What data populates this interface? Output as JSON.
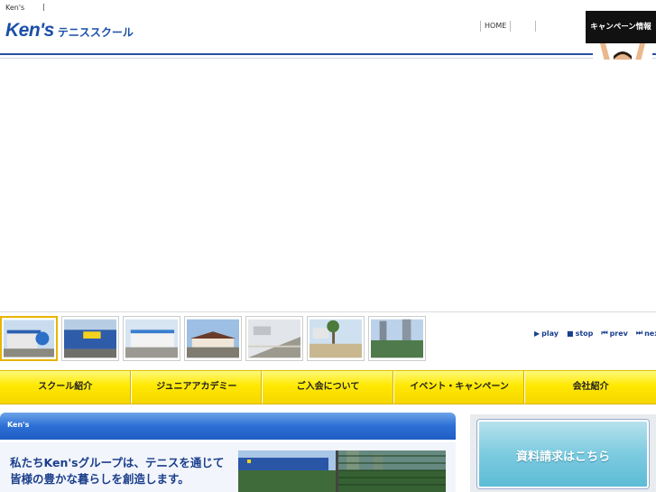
{
  "topbar": {
    "brand": "Ken's",
    "separator": "|"
  },
  "header": {
    "logo_brand": "Ken's",
    "logo_school": "テニススクール",
    "nav": [
      {
        "label": "HOME"
      },
      {
        "label": ""
      },
      {
        "label": ""
      }
    ]
  },
  "campaign": {
    "label": "キャンペーン情報"
  },
  "slideshow": {
    "thumbnails": [
      {
        "name": "thumb-1",
        "active": true
      },
      {
        "name": "thumb-2",
        "active": false
      },
      {
        "name": "thumb-3",
        "active": false
      },
      {
        "name": "thumb-4",
        "active": false
      },
      {
        "name": "thumb-5",
        "active": false
      },
      {
        "name": "thumb-6",
        "active": false
      },
      {
        "name": "thumb-7",
        "active": false
      }
    ],
    "controls": {
      "play": "play",
      "stop": "stop",
      "prev": "prev",
      "next": "next"
    }
  },
  "main_nav": {
    "items": [
      {
        "label": "スクール紹介"
      },
      {
        "label": "ジュニアアカデミー"
      },
      {
        "label": "ご入会について"
      },
      {
        "label": "イベント・キャンペーン"
      },
      {
        "label": "会社紹介"
      }
    ]
  },
  "section": {
    "bar_title": "Ken's"
  },
  "intro": {
    "headline_line1": "私たちKen'sグループは、テニスを通じて",
    "headline_line2": "皆様の豊かな暮らしを創造します。"
  },
  "side": {
    "request_button": "資料請求はこちら"
  },
  "colors": {
    "brand_blue": "#1a4fa8",
    "nav_yellow": "#ffe800",
    "section_blue": "#2c6fd6",
    "request_cyan": "#7ccbe0"
  }
}
